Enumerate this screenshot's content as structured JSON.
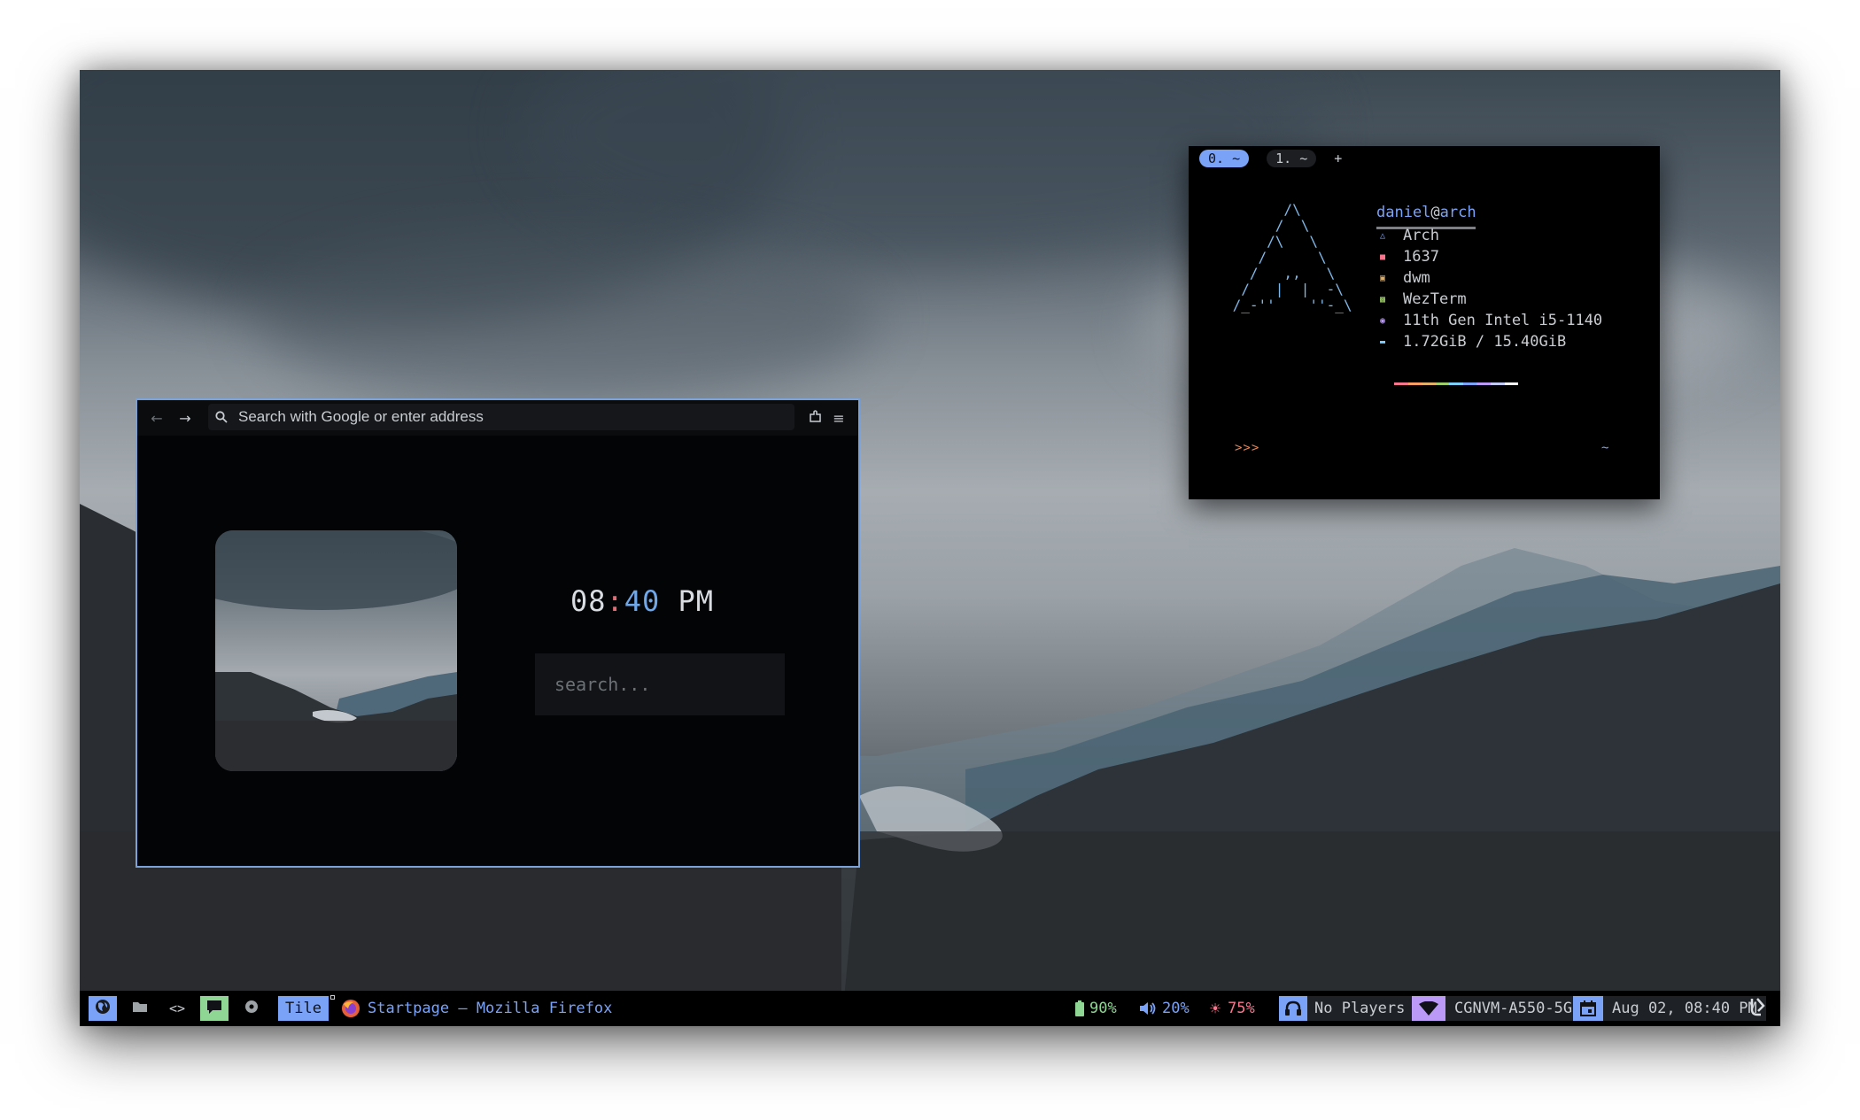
{
  "browser": {
    "url_placeholder": "Search with Google or enter address",
    "back_icon": "arrow-left-icon",
    "forward_icon": "arrow-right-icon",
    "extensions_icon": "puzzle-icon",
    "menu_icon": "hamburger-menu-icon",
    "clock": {
      "hours": "08",
      "separator": ":",
      "minutes": "40",
      "ampm": "PM"
    },
    "search_placeholder": "search...",
    "accent": "#7aa2d8"
  },
  "terminal": {
    "tabs": [
      {
        "label": "0. ~",
        "active": true
      },
      {
        "label": "1. ~",
        "active": false
      }
    ],
    "new_tab_label": "+",
    "ascii_logo": "       /\\\n      /  \\\n     /\\   \\\n    /      \\\n   /   ,,   \\\n  /   |  |  -\\\n /_-''    ''-_\\",
    "fetch": {
      "user": "daniel",
      "at": "@",
      "host": "arch",
      "rows": [
        {
          "icon": "tux-icon",
          "color": "#7aa2f7",
          "value": "Arch"
        },
        {
          "icon": "package-icon",
          "color": "#f7768e",
          "value": "1637"
        },
        {
          "icon": "window-icon",
          "color": "#e0af68",
          "value": "dwm"
        },
        {
          "icon": "terminal-icon",
          "color": "#9ece6a",
          "value": "WezTerm"
        },
        {
          "icon": "cpu-icon",
          "color": "#bb9af7",
          "value": "11th Gen Intel i5-1140"
        },
        {
          "icon": "memory-icon",
          "color": "#7dcfff",
          "value": "1.72GiB / 15.40GiB"
        }
      ],
      "palette": [
        "#f7768e",
        "#ff9e64",
        "#e0af68",
        "#9ece6a",
        "#7dcfff",
        "#7aa2f7",
        "#bb9af7",
        "#c0caf5",
        "#ffffff"
      ]
    },
    "prompt": ">>>",
    "prompt_path": "~"
  },
  "bar": {
    "tags": [
      {
        "icon": "globe-icon",
        "active": true,
        "color": "#7aa2f7"
      },
      {
        "icon": "folder-icon",
        "active": false
      },
      {
        "icon": "code-icon",
        "active": false
      },
      {
        "icon": "chat-icon",
        "active": true,
        "color": "#8fd694"
      },
      {
        "icon": "record-icon",
        "active": false
      }
    ],
    "layout": "Tile",
    "window_title": "Startpage — Mozilla Firefox",
    "battery": "90%",
    "volume": "20%",
    "brightness": "75%",
    "music": "No Players",
    "wifi": "CGNVM-A550-5G",
    "date": "Aug 02, 08:40 PM",
    "colors": {
      "battery": "#8fd694",
      "volume": "#7aa2f7",
      "brightness": "#f7768e",
      "accent": "#7aa2f7",
      "purple": "#bb9af7"
    }
  }
}
